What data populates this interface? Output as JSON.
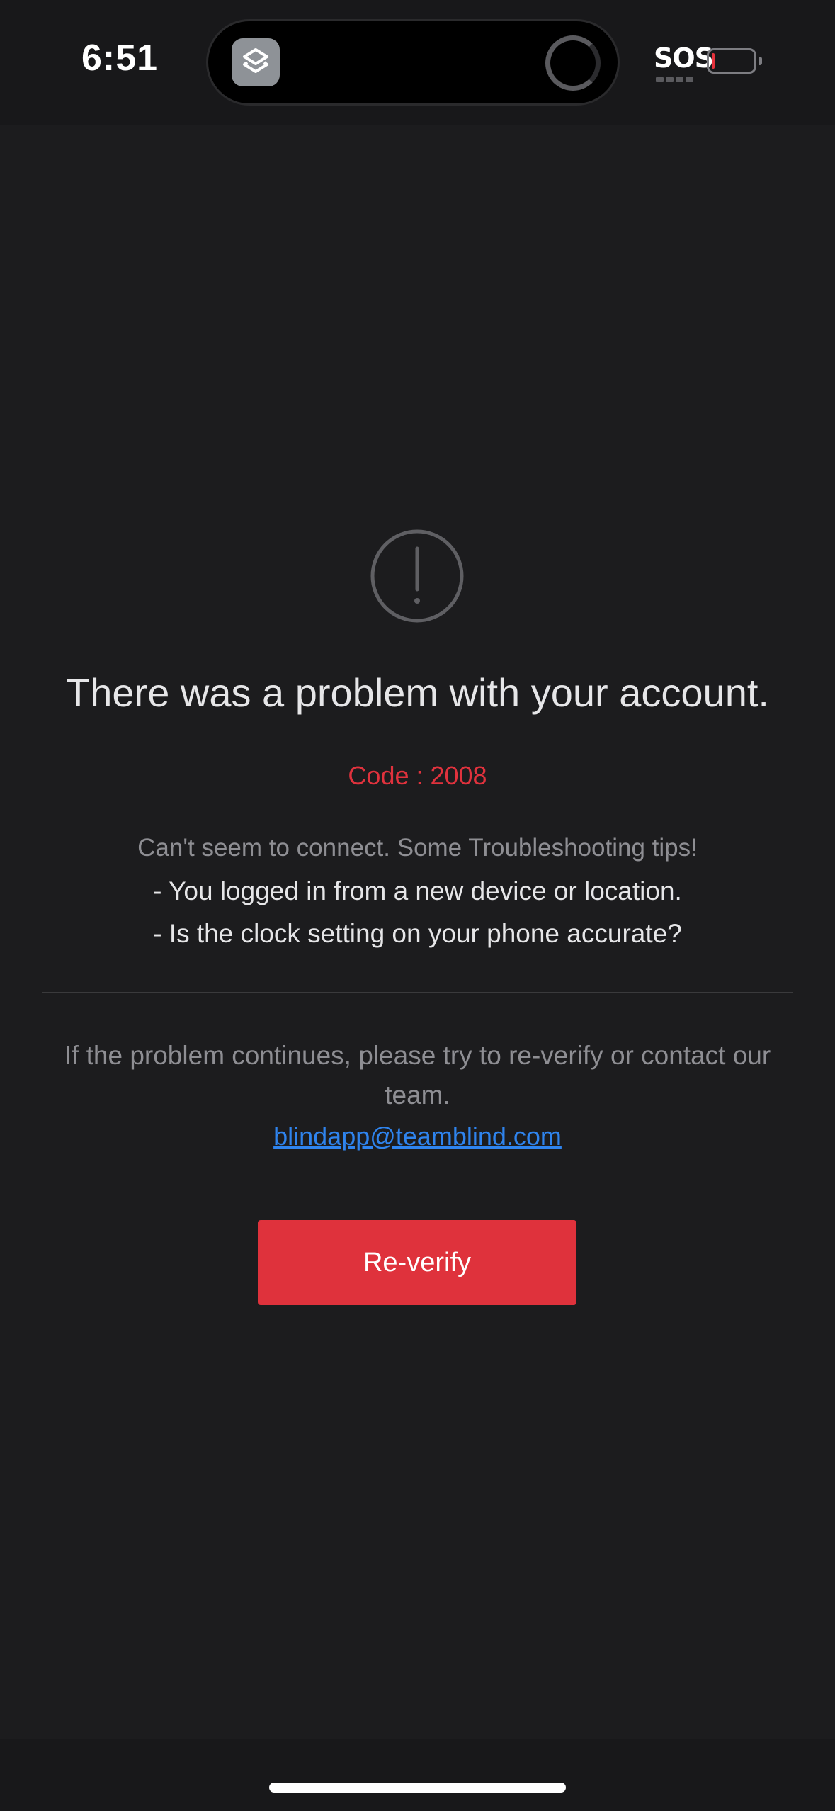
{
  "status_bar": {
    "time": "6:51",
    "carrier_status": "SOS",
    "battery_level_fraction": 0.08,
    "battery_color": "#e5323c",
    "app_icon": "layers-icon",
    "activity_icon": "loading-spinner-icon"
  },
  "error": {
    "icon": "exclamation-circle-icon",
    "title": "There was a problem with your account.",
    "code": "Code : 2008",
    "tips_intro": "Can't seem to connect. Some Troubleshooting tips!",
    "tips": [
      "- You logged in from a new device or location.",
      "- Is the clock setting on your phone accurate?"
    ],
    "continue_message": "If the problem continues, please try to re-verify or contact our team.",
    "contact_email": "blindapp@teamblind.com",
    "button_label": "Re-verify"
  },
  "colors": {
    "background": "#1c1c1e",
    "accent_red": "#df323c",
    "link_blue": "#2f84ee"
  }
}
